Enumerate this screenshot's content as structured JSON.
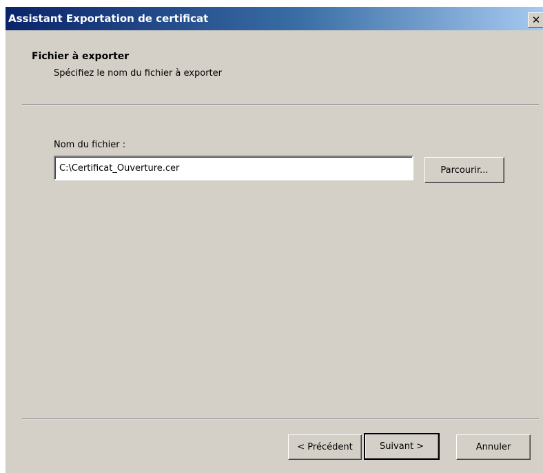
{
  "window": {
    "title": "Assistant Exportation de certificat",
    "close_glyph": "✕"
  },
  "header": {
    "title": "Fichier à exporter",
    "subtitle": "Spécifiez le nom du fichier à exporter"
  },
  "form": {
    "filename_label": "Nom du fichier :",
    "filename_value": "C:\\Certificat_Ouverture.cer",
    "browse_label": "Parcourir..."
  },
  "footer": {
    "previous_label": "< Précédent",
    "next_label": "Suivant >",
    "cancel_label": "Annuler"
  },
  "colors": {
    "dialog_background": "#d4d0c8",
    "titlebar_start": "#0a246a",
    "titlebar_end": "#a6caf0"
  }
}
